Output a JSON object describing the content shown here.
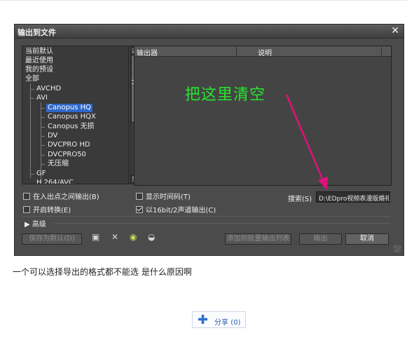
{
  "dialog": {
    "title": "输出到文件",
    "close_glyph": "✕",
    "tree": {
      "items": [
        {
          "label": "当前默认"
        },
        {
          "label": "最近使用"
        },
        {
          "label": "我的预设"
        },
        {
          "label": "全部"
        },
        {
          "label": "AVCHD"
        },
        {
          "label": "AVI"
        },
        {
          "label": "Canopus HQ",
          "selected": true
        },
        {
          "label": "Canopus HQX"
        },
        {
          "label": "Canopus 无损"
        },
        {
          "label": "DV"
        },
        {
          "label": "DVCPRO HD"
        },
        {
          "label": "DVCPRO50"
        },
        {
          "label": "无压缩"
        },
        {
          "label": "GF"
        },
        {
          "label": "H.264/AVC"
        }
      ]
    },
    "table": {
      "headers": [
        "输出器",
        "说明"
      ],
      "rows": []
    },
    "annotation": {
      "text": "把这里清空",
      "color": "#27e62d",
      "arrow_color": "#e0117a"
    },
    "options": {
      "export_between_marks": "在入出点之间输出(B)",
      "enable_conversion": "开启转换(E)",
      "show_timecode": "显示时间码(T)",
      "output_16bit_2ch": "以16bit/2声道输出(C)",
      "export_between_marks_checked": false,
      "enable_conversion_checked": false,
      "show_timecode_checked": false,
      "output_16bit_2ch_checked": true
    },
    "search": {
      "label": "搜索(S)",
      "value": "D:\\EDpro视频表漫版婚礼"
    },
    "advanced_label": "高级",
    "buttons": {
      "save_default": "保存为默认(D)",
      "add_batch": "添加到批量输出列表",
      "export": "输出",
      "cancel": "取消"
    },
    "icons": [
      "save-icon",
      "delete-icon",
      "import-icon",
      "export-icon"
    ]
  },
  "page": {
    "question": "一个可以选择导出的格式都不能选 是什么原因啊",
    "share_label": "分享",
    "share_count": "(0)"
  }
}
